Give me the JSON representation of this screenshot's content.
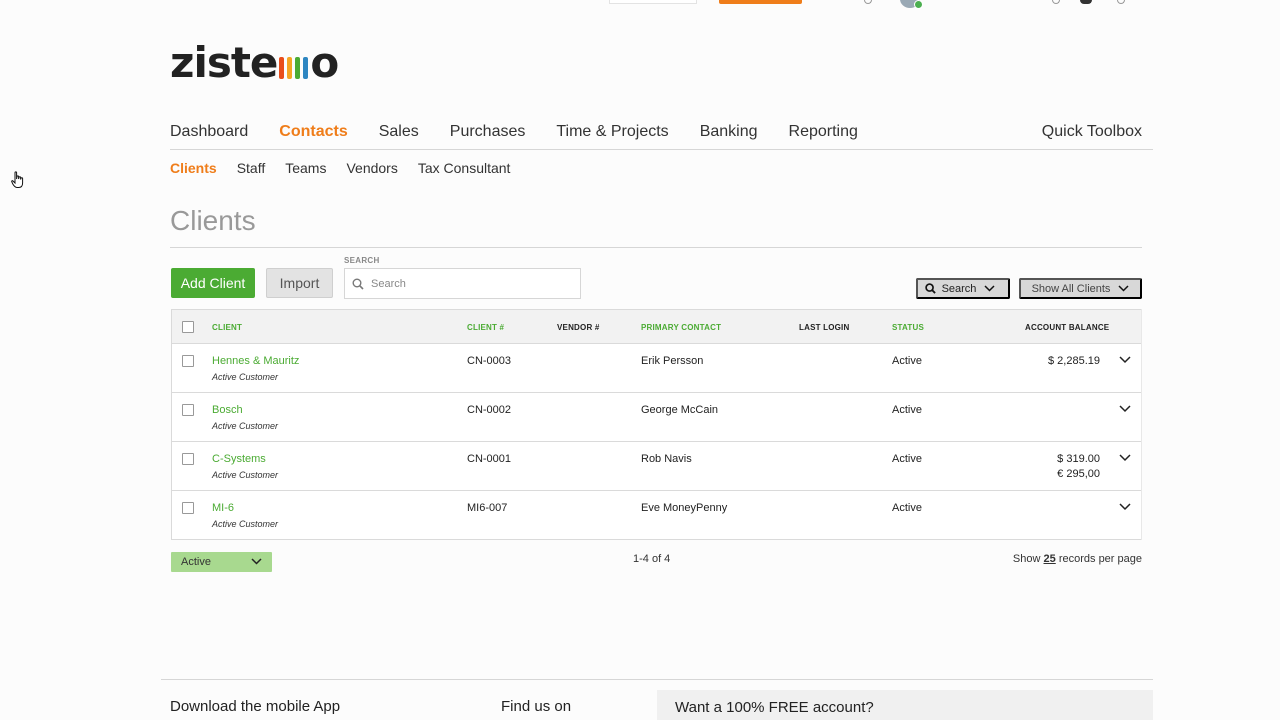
{
  "brand": {
    "logo_left": "ziste",
    "logo_right": "o",
    "logo_bar_colors": [
      "#e94e1b",
      "#f5a623",
      "#4bab33",
      "#2e86c1"
    ]
  },
  "colors": {
    "accent_orange": "#ef7d1a",
    "accent_green": "#4bab33",
    "status_select_green": "#a8d98f"
  },
  "main_nav": {
    "items": [
      {
        "label": "Dashboard"
      },
      {
        "label": "Contacts",
        "active": true
      },
      {
        "label": "Sales"
      },
      {
        "label": "Purchases"
      },
      {
        "label": "Time & Projects"
      },
      {
        "label": "Banking"
      },
      {
        "label": "Reporting"
      }
    ],
    "quick_toolbox": "Quick Toolbox"
  },
  "sub_nav": {
    "items": [
      {
        "label": "Clients",
        "active": true
      },
      {
        "label": "Staff"
      },
      {
        "label": "Teams"
      },
      {
        "label": "Vendors"
      },
      {
        "label": "Tax Consultant"
      }
    ]
  },
  "page": {
    "title": "Clients",
    "add_button": "Add Client",
    "import_button": "Import",
    "search_label": "SEARCH",
    "search_placeholder": "Search",
    "search_button": "Search",
    "filter_button": "Show All Clients"
  },
  "table": {
    "headers": {
      "client": "CLIENT",
      "client_no": "CLIENT #",
      "vendor_no": "VENDOR #",
      "primary_contact": "PRIMARY CONTACT",
      "last_login": "LAST LOGIN",
      "status": "STATUS",
      "account_balance": "ACCOUNT BALANCE"
    },
    "rows": [
      {
        "name": "Hennes & Mauritz",
        "type": "Active Customer",
        "client_no": "CN-0003",
        "vendor_no": "",
        "contact": "Erik Persson",
        "last_login": "",
        "status": "Active",
        "balance_1": "$ 2,285.19",
        "balance_2": ""
      },
      {
        "name": "Bosch",
        "type": "Active Customer",
        "client_no": "CN-0002",
        "vendor_no": "",
        "contact": "George McCain",
        "last_login": "",
        "status": "Active",
        "balance_1": "",
        "balance_2": ""
      },
      {
        "name": "C-Systems",
        "type": "Active Customer",
        "client_no": "CN-0001",
        "vendor_no": "",
        "contact": "Rob Navis",
        "last_login": "",
        "status": "Active",
        "balance_1": "$ 319.00",
        "balance_2": "€ 295,00"
      },
      {
        "name": "MI-6",
        "type": "Active Customer",
        "client_no": "MI6-007",
        "vendor_no": "",
        "contact": "Eve MoneyPenny",
        "last_login": "",
        "status": "Active",
        "balance_1": "",
        "balance_2": ""
      }
    ]
  },
  "table_footer": {
    "status_filter": "Active",
    "pagination": "1-4 of 4",
    "per_page_prefix": "Show",
    "per_page_value": "25",
    "per_page_suffix": "records per page"
  },
  "footer": {
    "mobile_app": "Download the mobile App",
    "find_us": "Find us on",
    "promo": "Want a 100% FREE account?"
  }
}
